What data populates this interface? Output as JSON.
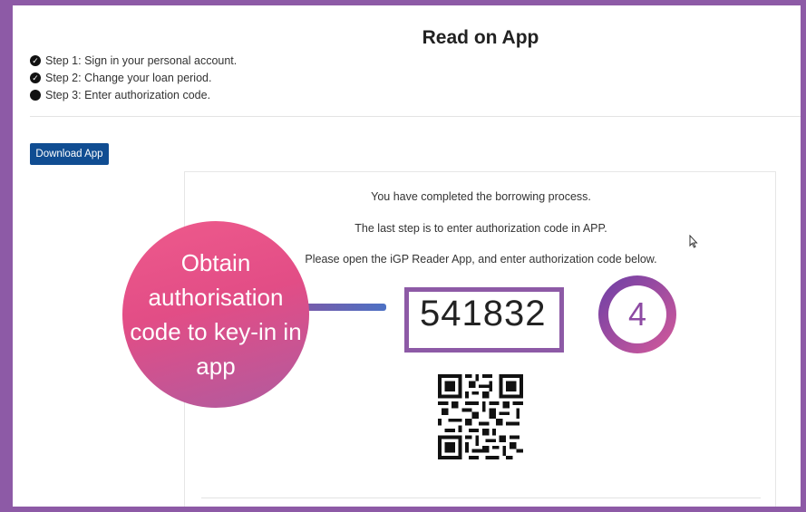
{
  "page": {
    "title": "Read on App"
  },
  "steps": [
    {
      "label": "Step 1: Sign in your personal account.",
      "status": "done",
      "icon": "check-circle-icon"
    },
    {
      "label": "Step 2: Change your loan period.",
      "status": "done",
      "icon": "check-circle-icon"
    },
    {
      "label": "Step 3: Enter authorization code.",
      "status": "current",
      "icon": "filled-circle-icon"
    }
  ],
  "toolbar": {
    "download_label": "Download App"
  },
  "card": {
    "line1": "You have completed the borrowing process.",
    "line2": "The last step is to enter authorization code in APP.",
    "line3": "Please open the iGP Reader App, and enter authorization code below.",
    "authorization_code": "541832"
  },
  "annotation": {
    "bubble_text": "Obtain authorisation code to key-in in app",
    "step_number": "4"
  },
  "colors": {
    "frame": "#8d5aa6",
    "button": "#104d92",
    "bubble_start": "#ee5a8c",
    "bubble_end": "#b05b9f"
  }
}
